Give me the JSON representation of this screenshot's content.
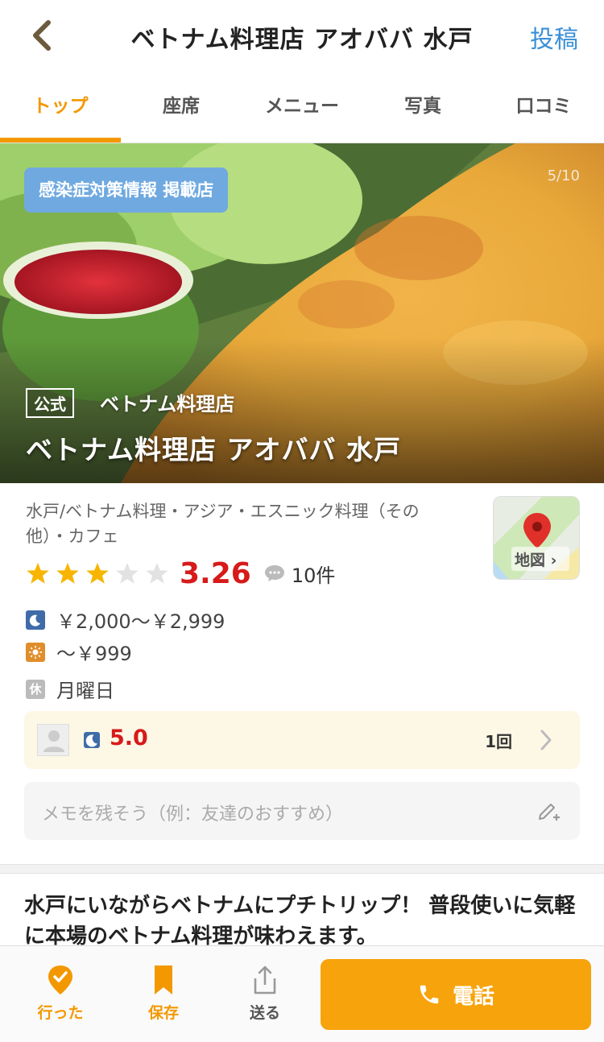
{
  "header": {
    "title": "ベトナム料理店 アオババ  水戸",
    "post_label": "投稿"
  },
  "tabs": [
    {
      "label": "トップ",
      "active": true
    },
    {
      "label": "座席",
      "active": false
    },
    {
      "label": "メニュー",
      "active": false
    },
    {
      "label": "写真",
      "active": false
    },
    {
      "label": "口コミ",
      "active": false
    }
  ],
  "hero": {
    "covid_badge": "感染症対策情報 掲載店",
    "photo_count": "5/10",
    "official_label": "公式",
    "genre": "ベトナム料理店",
    "name": "ベトナム料理店 アオババ  水戸"
  },
  "info": {
    "category": "水戸/ベトナム料理・アジア・エスニック料理（その他）・カフェ",
    "rating_value": "3.26",
    "stars_filled": 3,
    "stars_total": 5,
    "reviews": "10件",
    "dinner_price": "￥2,000～￥2,999",
    "lunch_price": "～￥999",
    "holiday_icon": "休",
    "holiday": "月曜日",
    "map_label": "地図 ›"
  },
  "my_review": {
    "score": "5.0",
    "visits": "1回"
  },
  "memo": {
    "placeholder": "メモを残そう（例：友達のおすすめ）"
  },
  "pr_text": "水戸にいながらベトナムにプチトリップ！ 普段使いに気軽に本場のベトナム料理が味わえます。",
  "bottom_bar": {
    "went_label": "行った",
    "save_label": "保存",
    "send_label": "送る",
    "call_label": "電話"
  },
  "colors": {
    "accent": "#f39800",
    "score_red": "#d71a1a",
    "link_blue": "#3a8fd6",
    "badge_blue": "#6fa9e0"
  }
}
